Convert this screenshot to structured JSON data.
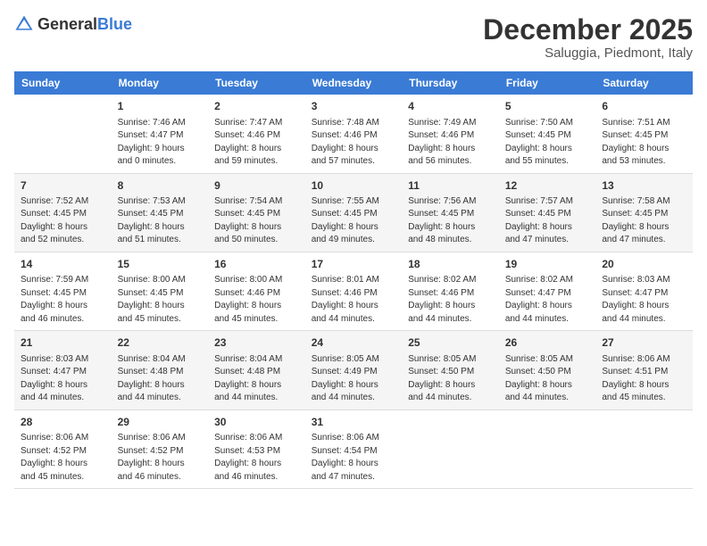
{
  "logo": {
    "general": "General",
    "blue": "Blue"
  },
  "title": "December 2025",
  "location": "Saluggia, Piedmont, Italy",
  "days_header": [
    "Sunday",
    "Monday",
    "Tuesday",
    "Wednesday",
    "Thursday",
    "Friday",
    "Saturday"
  ],
  "weeks": [
    [
      {
        "day": "",
        "info": ""
      },
      {
        "day": "1",
        "info": "Sunrise: 7:46 AM\nSunset: 4:47 PM\nDaylight: 9 hours\nand 0 minutes."
      },
      {
        "day": "2",
        "info": "Sunrise: 7:47 AM\nSunset: 4:46 PM\nDaylight: 8 hours\nand 59 minutes."
      },
      {
        "day": "3",
        "info": "Sunrise: 7:48 AM\nSunset: 4:46 PM\nDaylight: 8 hours\nand 57 minutes."
      },
      {
        "day": "4",
        "info": "Sunrise: 7:49 AM\nSunset: 4:46 PM\nDaylight: 8 hours\nand 56 minutes."
      },
      {
        "day": "5",
        "info": "Sunrise: 7:50 AM\nSunset: 4:45 PM\nDaylight: 8 hours\nand 55 minutes."
      },
      {
        "day": "6",
        "info": "Sunrise: 7:51 AM\nSunset: 4:45 PM\nDaylight: 8 hours\nand 53 minutes."
      }
    ],
    [
      {
        "day": "7",
        "info": "Sunrise: 7:52 AM\nSunset: 4:45 PM\nDaylight: 8 hours\nand 52 minutes."
      },
      {
        "day": "8",
        "info": "Sunrise: 7:53 AM\nSunset: 4:45 PM\nDaylight: 8 hours\nand 51 minutes."
      },
      {
        "day": "9",
        "info": "Sunrise: 7:54 AM\nSunset: 4:45 PM\nDaylight: 8 hours\nand 50 minutes."
      },
      {
        "day": "10",
        "info": "Sunrise: 7:55 AM\nSunset: 4:45 PM\nDaylight: 8 hours\nand 49 minutes."
      },
      {
        "day": "11",
        "info": "Sunrise: 7:56 AM\nSunset: 4:45 PM\nDaylight: 8 hours\nand 48 minutes."
      },
      {
        "day": "12",
        "info": "Sunrise: 7:57 AM\nSunset: 4:45 PM\nDaylight: 8 hours\nand 47 minutes."
      },
      {
        "day": "13",
        "info": "Sunrise: 7:58 AM\nSunset: 4:45 PM\nDaylight: 8 hours\nand 47 minutes."
      }
    ],
    [
      {
        "day": "14",
        "info": "Sunrise: 7:59 AM\nSunset: 4:45 PM\nDaylight: 8 hours\nand 46 minutes."
      },
      {
        "day": "15",
        "info": "Sunrise: 8:00 AM\nSunset: 4:45 PM\nDaylight: 8 hours\nand 45 minutes."
      },
      {
        "day": "16",
        "info": "Sunrise: 8:00 AM\nSunset: 4:46 PM\nDaylight: 8 hours\nand 45 minutes."
      },
      {
        "day": "17",
        "info": "Sunrise: 8:01 AM\nSunset: 4:46 PM\nDaylight: 8 hours\nand 44 minutes."
      },
      {
        "day": "18",
        "info": "Sunrise: 8:02 AM\nSunset: 4:46 PM\nDaylight: 8 hours\nand 44 minutes."
      },
      {
        "day": "19",
        "info": "Sunrise: 8:02 AM\nSunset: 4:47 PM\nDaylight: 8 hours\nand 44 minutes."
      },
      {
        "day": "20",
        "info": "Sunrise: 8:03 AM\nSunset: 4:47 PM\nDaylight: 8 hours\nand 44 minutes."
      }
    ],
    [
      {
        "day": "21",
        "info": "Sunrise: 8:03 AM\nSunset: 4:47 PM\nDaylight: 8 hours\nand 44 minutes."
      },
      {
        "day": "22",
        "info": "Sunrise: 8:04 AM\nSunset: 4:48 PM\nDaylight: 8 hours\nand 44 minutes."
      },
      {
        "day": "23",
        "info": "Sunrise: 8:04 AM\nSunset: 4:48 PM\nDaylight: 8 hours\nand 44 minutes."
      },
      {
        "day": "24",
        "info": "Sunrise: 8:05 AM\nSunset: 4:49 PM\nDaylight: 8 hours\nand 44 minutes."
      },
      {
        "day": "25",
        "info": "Sunrise: 8:05 AM\nSunset: 4:50 PM\nDaylight: 8 hours\nand 44 minutes."
      },
      {
        "day": "26",
        "info": "Sunrise: 8:05 AM\nSunset: 4:50 PM\nDaylight: 8 hours\nand 44 minutes."
      },
      {
        "day": "27",
        "info": "Sunrise: 8:06 AM\nSunset: 4:51 PM\nDaylight: 8 hours\nand 45 minutes."
      }
    ],
    [
      {
        "day": "28",
        "info": "Sunrise: 8:06 AM\nSunset: 4:52 PM\nDaylight: 8 hours\nand 45 minutes."
      },
      {
        "day": "29",
        "info": "Sunrise: 8:06 AM\nSunset: 4:52 PM\nDaylight: 8 hours\nand 46 minutes."
      },
      {
        "day": "30",
        "info": "Sunrise: 8:06 AM\nSunset: 4:53 PM\nDaylight: 8 hours\nand 46 minutes."
      },
      {
        "day": "31",
        "info": "Sunrise: 8:06 AM\nSunset: 4:54 PM\nDaylight: 8 hours\nand 47 minutes."
      },
      {
        "day": "",
        "info": ""
      },
      {
        "day": "",
        "info": ""
      },
      {
        "day": "",
        "info": ""
      }
    ]
  ]
}
